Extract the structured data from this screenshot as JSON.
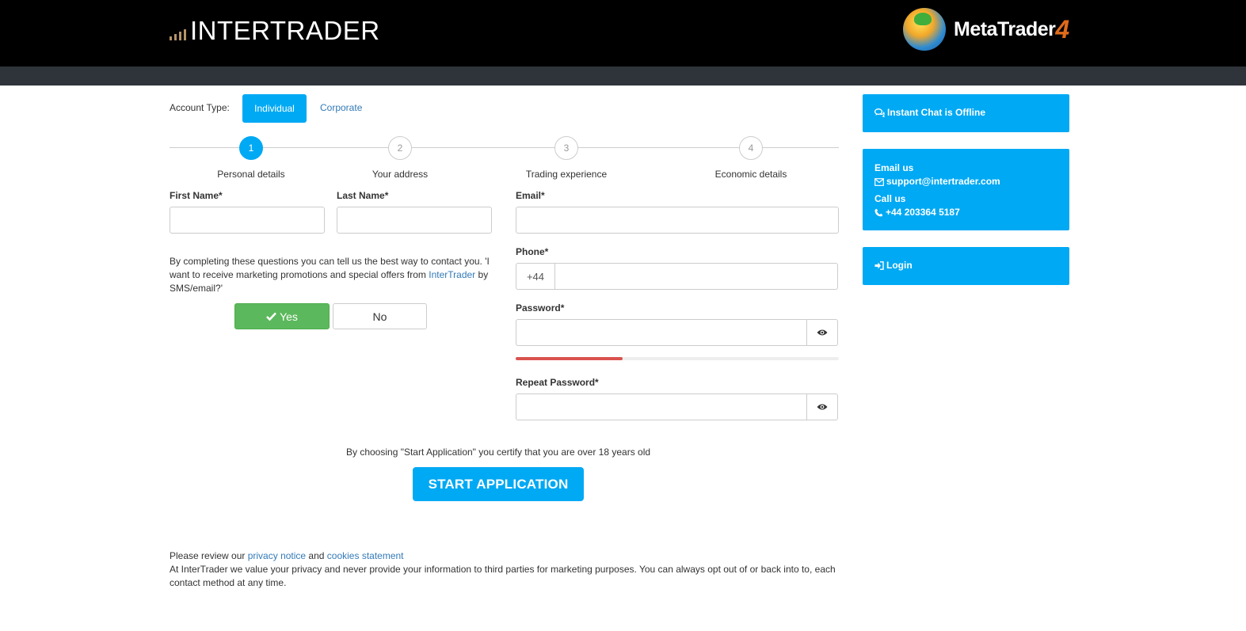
{
  "header": {
    "brand": "INTERTRADER",
    "platform_name": "MetaTrader",
    "platform_version": "4",
    "brand_accent_color": "#b5936a",
    "platform_accent_color": "#e06b1b"
  },
  "account_type": {
    "label": "Account Type:",
    "options": [
      "Individual",
      "Corporate"
    ],
    "selected": "Individual"
  },
  "steps": [
    {
      "number": "1",
      "label": "Personal details",
      "active": true
    },
    {
      "number": "2",
      "label": "Your address",
      "active": false
    },
    {
      "number": "3",
      "label": "Trading experience",
      "active": false
    },
    {
      "number": "4",
      "label": "Economic details",
      "active": false
    }
  ],
  "form": {
    "first_name": {
      "label": "First Name*",
      "value": ""
    },
    "last_name": {
      "label": "Last Name*",
      "value": ""
    },
    "email": {
      "label": "Email*",
      "value": ""
    },
    "phone": {
      "label": "Phone*",
      "prefix": "+44",
      "value": ""
    },
    "password": {
      "label": "Password*",
      "value": "",
      "strength": 0.33
    },
    "repeat_password": {
      "label": "Repeat Password*",
      "value": ""
    }
  },
  "consent": {
    "text_1": "By completing these questions you can tell us the best way to contact you. 'I want to receive marketing promotions and special offers from ",
    "link": "InterTrader",
    "text_2": " by SMS/email?'",
    "yes_label": "Yes",
    "no_label": "No",
    "selected": "Yes"
  },
  "certify_text": "By choosing \"Start Application\" you certify that you are over 18 years old",
  "start_button": "START APPLICATION",
  "footer": {
    "review_prefix": "Please review our ",
    "privacy_link": "privacy notice",
    "and": " and ",
    "cookies_link": "cookies statement",
    "privacy_text": "At InterTrader we value your privacy and never provide your information to third parties for marketing purposes. You can always opt out of or back into to, each contact method at any time."
  },
  "sidebar": {
    "chat": "Instant Chat is Offline",
    "email_heading": "Email us",
    "email": "support@intertrader.com",
    "call_heading": "Call us",
    "phone": "+44 203364 5187",
    "login": "Login"
  },
  "colors": {
    "primary": "#00a9f4",
    "success": "#5cb85c",
    "link": "#337ab7",
    "danger": "#d9534f",
    "header_bg": "#000000",
    "subbar_bg": "#2f343b"
  }
}
